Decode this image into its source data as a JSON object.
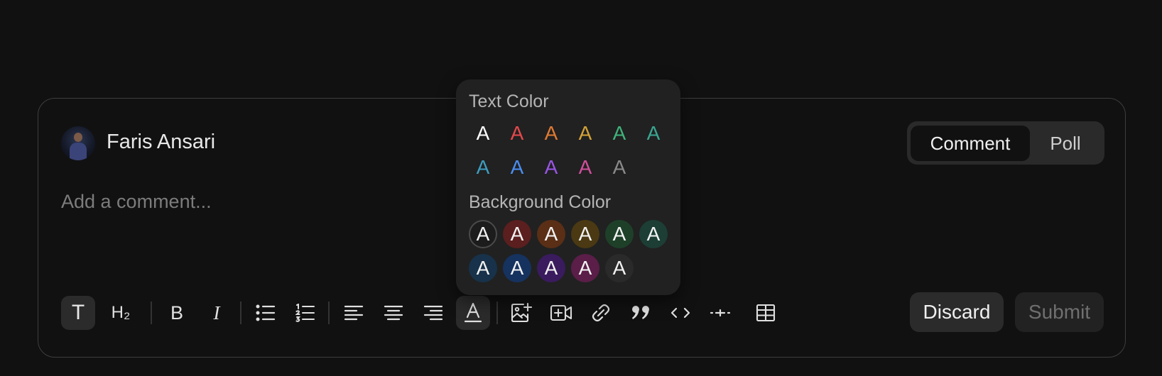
{
  "user": {
    "name": "Faris Ansari"
  },
  "editor": {
    "placeholder": "Add a comment..."
  },
  "mode_toggle": {
    "options": [
      "Comment",
      "Poll"
    ],
    "selected": "Comment"
  },
  "toolbar": {
    "text_glyph": "T",
    "heading_glyph": "H₂",
    "bold_glyph": "B",
    "italic_glyph": "I",
    "icons": [
      "paragraph-icon",
      "heading-icon",
      "bold-icon",
      "italic-icon",
      "bullet-list-icon",
      "numbered-list-icon",
      "align-left-icon",
      "align-center-icon",
      "align-right-icon",
      "text-color-icon",
      "image-icon",
      "video-icon",
      "link-icon",
      "blockquote-icon",
      "code-icon",
      "horizontal-rule-icon",
      "table-icon"
    ],
    "active": "text-color"
  },
  "actions": {
    "discard_label": "Discard",
    "submit_label": "Submit"
  },
  "color_popover": {
    "text_title": "Text Color",
    "background_title": "Background Color",
    "letter": "A",
    "text_colors": [
      "#ffffff",
      "#e5484d",
      "#e07a32",
      "#d5a338",
      "#3eb37a",
      "#3aa692",
      "#3f9cbf",
      "#4a8ef0",
      "#9a55e6",
      "#d24f9d",
      "#8a8a8a"
    ],
    "background_colors": [
      "#1c1c1c",
      "#5a1f1e",
      "#5a2f16",
      "#4a3912",
      "#1e4029",
      "#1c3e35",
      "#17324a",
      "#16325f",
      "#3a1b5e",
      "#5a1e48",
      "#2a2a2a"
    ]
  }
}
